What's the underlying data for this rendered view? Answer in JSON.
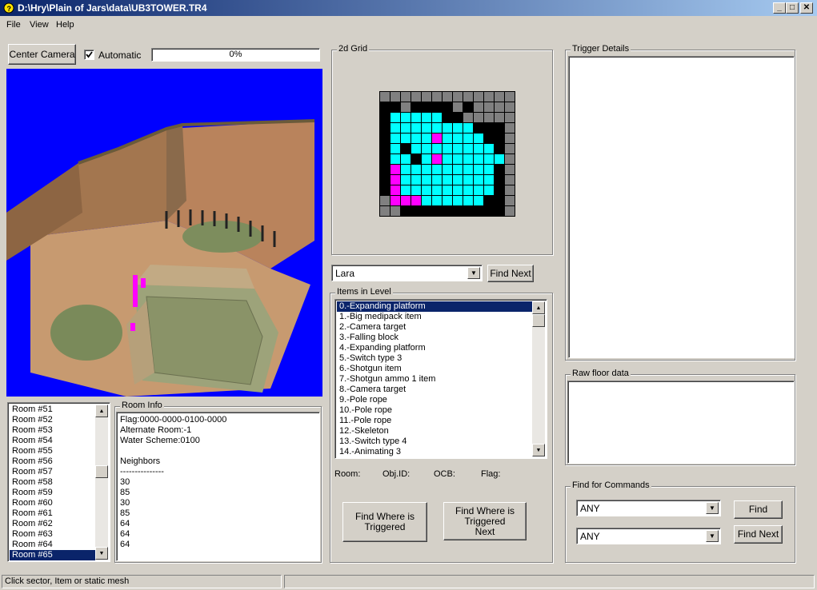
{
  "window": {
    "title": "D:\\Hry\\Plain of Jars\\data\\UB3TOWER.TR4",
    "minimize": "_",
    "maximize": "□",
    "close": "✕"
  },
  "menu": {
    "file": "File",
    "view": "View",
    "help": "Help"
  },
  "toolbar": {
    "center_camera": "Center Camera",
    "automatic_label": "Automatic",
    "automatic_checked": true,
    "progress_text": "0%",
    "progress": 0
  },
  "grid": {
    "label": "2d Grid",
    "cells": [
      "ggggggggggggg",
      "bbgbbbbgbgggg",
      "bcccccbbggggg",
      "bccccccccbbbg",
      "bccccmccccbbg",
      "bcbccccccccbg",
      "bccbcmccccccg",
      "bmcccccccccbg",
      "bmcccccccccbg",
      "bmcccccccccbg",
      "gmmmccccccbbg",
      "ggbbbbbbbbbbg"
    ]
  },
  "object_select": {
    "value": "Lara",
    "find_next": "Find Next"
  },
  "items": {
    "label": "Items in Level",
    "list": [
      "0.-Expanding platform",
      "1.-Big medipack item",
      "2.-Camera target",
      "3.-Falling block",
      "4.-Expanding platform",
      "5.-Switch type 3",
      "6.-Shotgun item",
      "7.-Shotgun ammo 1 item",
      "8.-Camera target",
      "9.-Pole rope",
      "10.-Pole rope",
      "11.-Pole rope",
      "12.-Skeleton",
      "13.-Switch type 4",
      "14.-Animating 3"
    ],
    "selected_index": 0,
    "room_label": "Room:",
    "objid_label": "Obj.ID:",
    "ocb_label": "OCB:",
    "flag_label": "Flag:",
    "find_where_triggered": "Find Where is Triggered",
    "find_where_triggered_next": "Find Where is Triggered Next"
  },
  "trigger_details": {
    "label": "Trigger Details"
  },
  "raw_floor": {
    "label": "Raw floor data"
  },
  "find_commands": {
    "label": "Find for Commands",
    "combo1": "ANY",
    "combo2": "ANY",
    "find": "Find",
    "find_next": "Find Next"
  },
  "rooms": {
    "list": [
      "Room #51",
      "Room #52",
      "Room #53",
      "Room #54",
      "Room #55",
      "Room #56",
      "Room #57",
      "Room #58",
      "Room #59",
      "Room #60",
      "Room #61",
      "Room #62",
      "Room #63",
      "Room #64",
      "Room #65"
    ],
    "selected_index": 14
  },
  "room_info": {
    "label": "Room Info",
    "lines": [
      "Flag:0000-0000-0100-0000",
      "Alternate Room:-1",
      "Water Scheme:0100",
      "",
      "Neighbors",
      "---------------",
      "30",
      "85",
      "30",
      "85",
      "64",
      "64",
      "64"
    ]
  },
  "status": {
    "text": "Click sector, Item or static mesh"
  },
  "colors": {
    "viewport_bg": "#0000ff",
    "selection": "#0a246a",
    "grid_cyan": "#00ffff",
    "grid_magenta": "#ff00ff"
  }
}
